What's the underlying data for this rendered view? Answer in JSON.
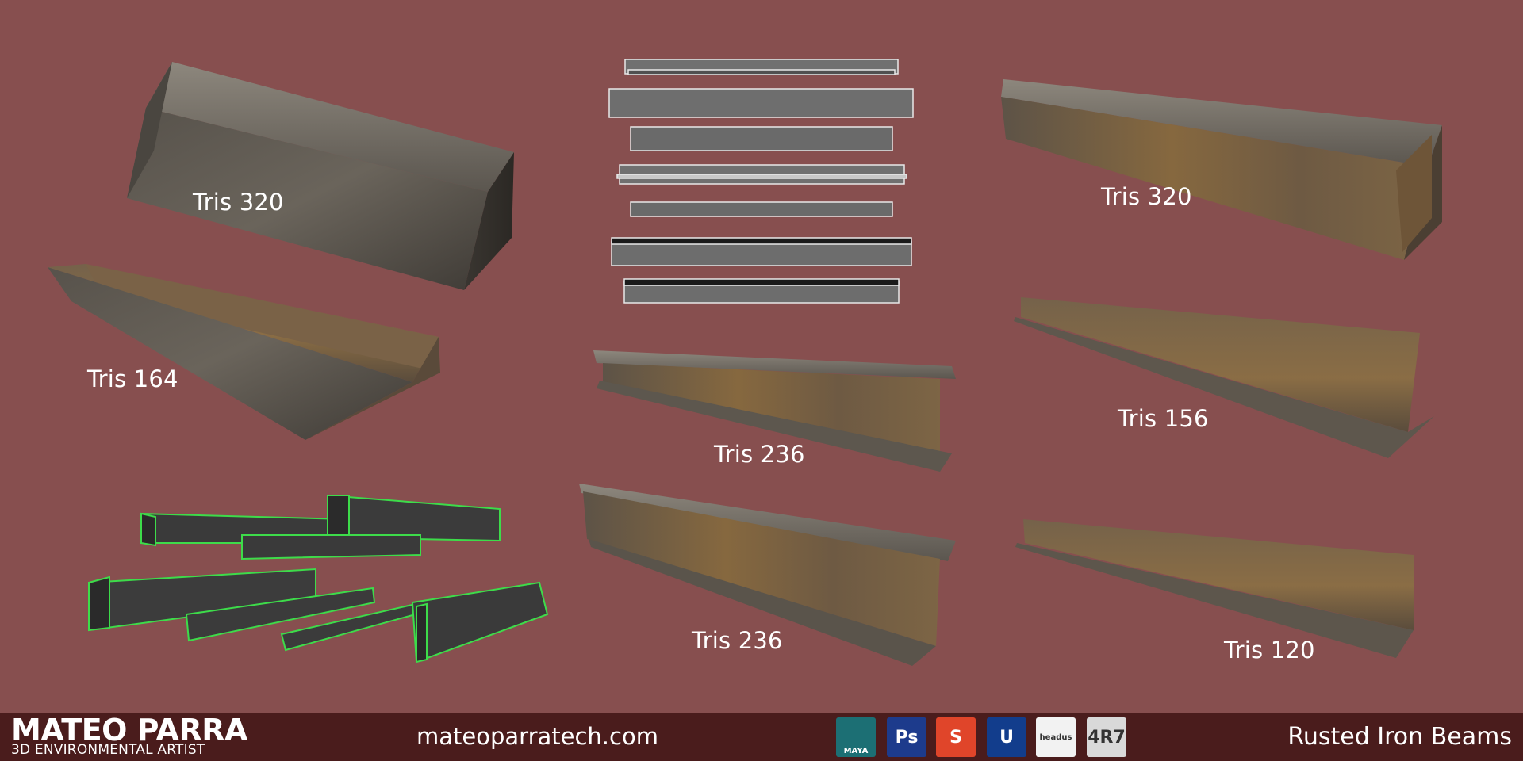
{
  "labels": {
    "tris_square_left": "Tris 320",
    "tris_channel_left": "Tris 164",
    "tris_ibeam_mid_top": "Tris 236",
    "tris_ibeam_mid_bottom": "Tris 236",
    "tris_square_right": "Tris 320",
    "tris_angle_right_top": "Tris 156",
    "tris_angle_right_bottom": "Tris 120"
  },
  "footer": {
    "name": "MATEO PARRA",
    "role": "3D ENVIRONMENTAL ARTIST",
    "website": "mateoparratech.com",
    "title": "Rusted Iron Beams"
  },
  "tools": [
    {
      "name": "maya-icon",
      "label": "MAYA",
      "bg": "#1c6f74"
    },
    {
      "name": "photoshop-icon",
      "label": "Ps",
      "bg": "#1d3b8c"
    },
    {
      "name": "substance-icon",
      "label": "S",
      "bg": "#e0452a"
    },
    {
      "name": "unreal-icon",
      "label": "U",
      "bg": "#123d8c"
    },
    {
      "name": "uvlayout-icon",
      "label": "headus",
      "bg": "#f2f2f2"
    },
    {
      "name": "zbrush-icon",
      "label": "4R7",
      "bg": "#d9d9d9"
    }
  ],
  "colors": {
    "background": "#874f4f",
    "footer": "#4a1c1c",
    "wire_green": "#3ddc4a",
    "metal_dark": "#4c4842",
    "rust": "#7d5f3e"
  }
}
